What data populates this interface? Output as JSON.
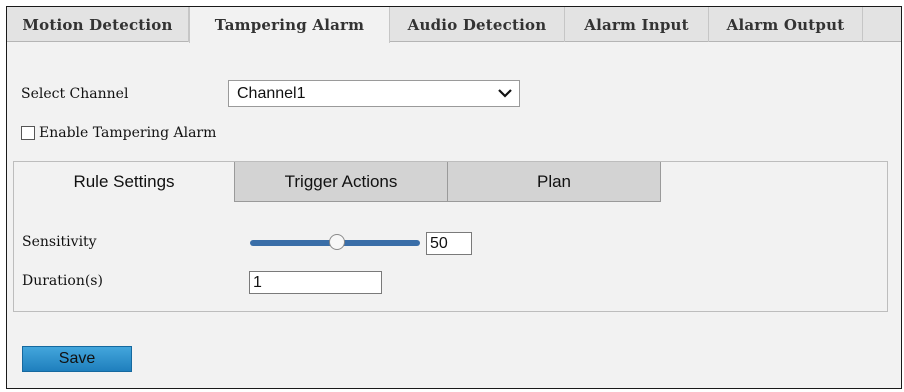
{
  "top_tabs": [
    {
      "label": "Motion Detection"
    },
    {
      "label": "Tampering Alarm",
      "active": true
    },
    {
      "label": "Audio Detection"
    },
    {
      "label": "Alarm Input"
    },
    {
      "label": "Alarm Output"
    }
  ],
  "select_channel": {
    "label": "Select Channel",
    "value": "Channel1"
  },
  "enable_tampering": {
    "label": "Enable Tampering Alarm",
    "checked": false
  },
  "sub_tabs": [
    {
      "label": "Rule Settings",
      "active": true
    },
    {
      "label": "Trigger Actions"
    },
    {
      "label": "Plan"
    }
  ],
  "sensitivity": {
    "label": "Sensitivity",
    "value": "50",
    "level_percent": 50
  },
  "duration": {
    "label": "Duration(s)",
    "value": "1"
  },
  "save_label": "Save",
  "colors": {
    "accent": "#2d8fd0",
    "slider": "#3a6ea8",
    "tab_bg": "#e3e3e3",
    "panel_bg": "#f2f2f2"
  },
  "icons": {
    "dropdown": "chevron-down-icon",
    "checkbox": "checkbox-unchecked-icon"
  }
}
